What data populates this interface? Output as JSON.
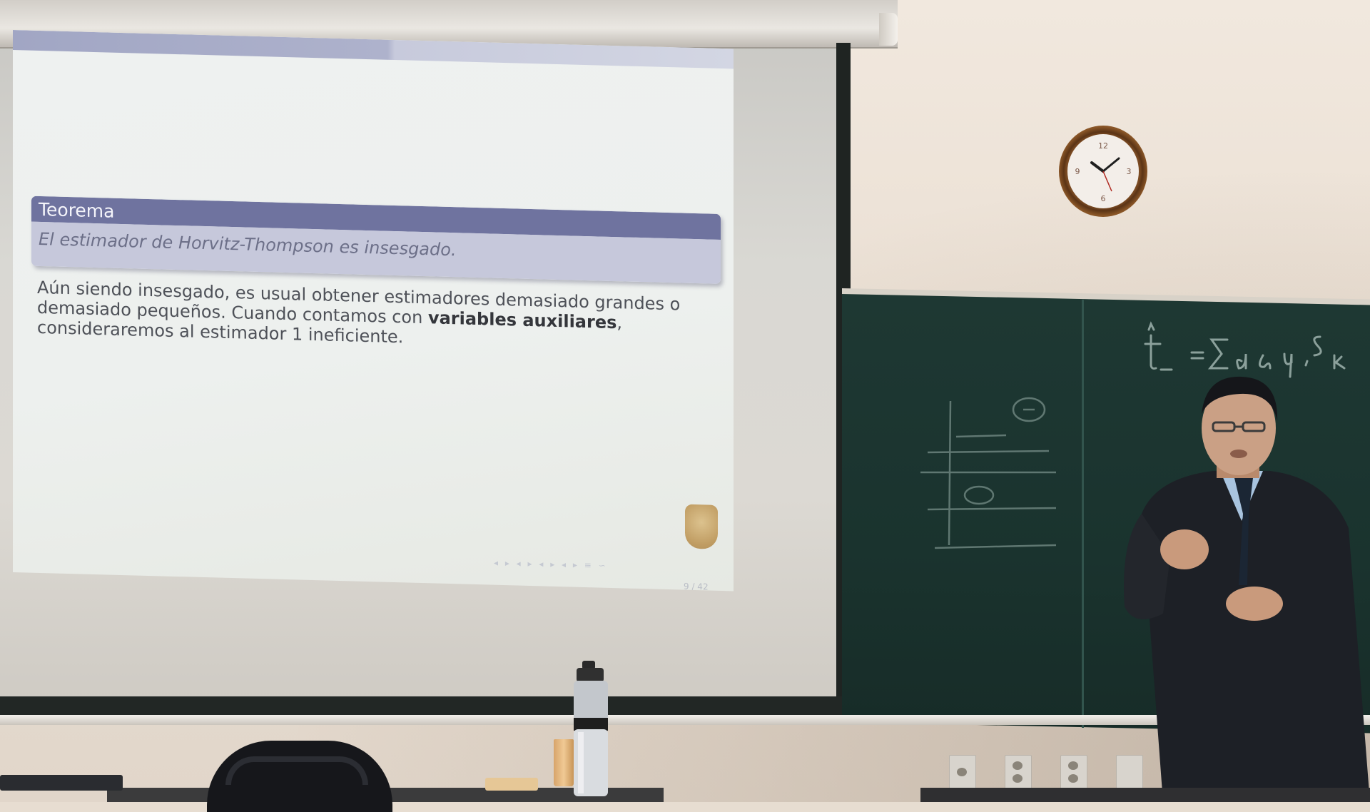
{
  "slide": {
    "theorem_title": "Teorema",
    "theorem_body": "El estimador de Horvitz-Thompson es insesgado.",
    "paragraph_part1": "Aún siendo insesgado, es usual obtener estimadores demasiado grandes o demasiado pequeños. Cuando contamos con ",
    "paragraph_bold": "variables auxiliares",
    "paragraph_part2": ", consideraremos al estimador 1 ineficiente.",
    "page_number": "9 / 42"
  },
  "colors": {
    "theorem_header": "#6f739f",
    "theorem_body_bg": "#c6c8db",
    "blackboard": "#1e3833",
    "wall": "#efe6dc"
  }
}
